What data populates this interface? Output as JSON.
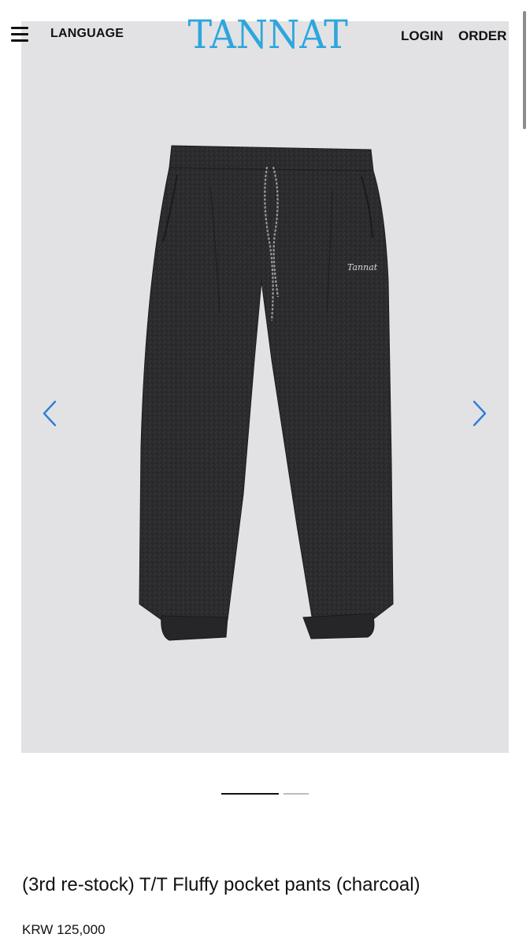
{
  "header": {
    "menu_icon": "hamburger-menu-icon",
    "language_label": "LANGUAGE",
    "logo_text": "TANNAT",
    "login_label": "LOGIN",
    "order_label": "ORDER"
  },
  "gallery": {
    "prev_icon": "chevron-left-icon",
    "next_icon": "chevron-right-icon",
    "slide_count": 2,
    "active_slide": 1,
    "product_image_label": "Tannat",
    "colors": {
      "background": "#e2e2e5",
      "garment": "#2c2c2e",
      "arrow": "#2e7fd6"
    }
  },
  "product": {
    "title": "(3rd re-stock) T/T Fluffy pocket pants (charcoal)",
    "price": "KRW 125,000"
  },
  "colors": {
    "logo": "#2ea6dc"
  }
}
